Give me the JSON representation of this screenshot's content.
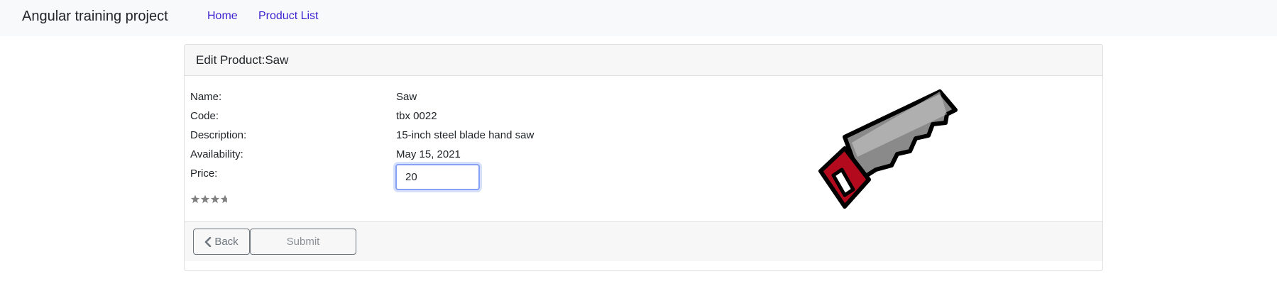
{
  "navbar": {
    "brand": "Angular training project",
    "links": [
      {
        "label": "Home"
      },
      {
        "label": "Product List"
      }
    ]
  },
  "card": {
    "title": "Edit Product:Saw",
    "fields": [
      {
        "label": "Name:",
        "value": "Saw"
      },
      {
        "label": "Code:",
        "value": "tbx 0022"
      },
      {
        "label": "Description:",
        "value": "15-inch steel blade hand saw"
      },
      {
        "label": "Availability:",
        "value": "May 15, 2021"
      }
    ],
    "price": {
      "label": "Price:",
      "value": "20"
    },
    "rating": {
      "stars_filled": 3.7,
      "stars_max": 5,
      "color": "#808080"
    },
    "image": {
      "icon": "saw-icon",
      "handle_color": "#b30b1d",
      "blade_color": "#8a8a8a"
    }
  },
  "footer": {
    "back_label": "Back",
    "submit_label": "Submit"
  },
  "colors": {
    "link": "#3b1fd1",
    "navbar_bg": "#f8f9fa",
    "focus_border": "#86a0f5"
  }
}
